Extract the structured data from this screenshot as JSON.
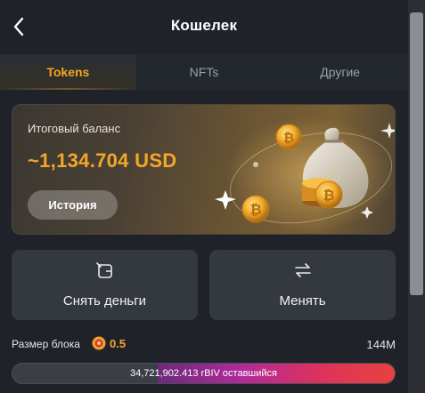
{
  "header": {
    "title": "Кошелек"
  },
  "tabs": [
    {
      "label": "Tokens",
      "active": true
    },
    {
      "label": "NFTs",
      "active": false
    },
    {
      "label": "Другие",
      "active": false
    }
  ],
  "balance": {
    "label": "Итоговый баланс",
    "amount": "~1,134.704 USD",
    "history_label": "История"
  },
  "actions": {
    "withdraw_label": "Снять деньги",
    "exchange_label": "Менять"
  },
  "block": {
    "label": "Размер блока",
    "value": "0.5",
    "total": "144M",
    "remaining_text": "34,721,902.413 rBIV оставшийся",
    "remaining_fraction": 0.62
  },
  "colors": {
    "accent": "#f4a629",
    "background": "#1f2329",
    "button": "#34383f"
  },
  "icons": {
    "back": "chevron-left-icon",
    "withdraw": "wallet-out-icon",
    "exchange": "swap-arrows-icon",
    "coin": "rbiv-coin-icon"
  }
}
